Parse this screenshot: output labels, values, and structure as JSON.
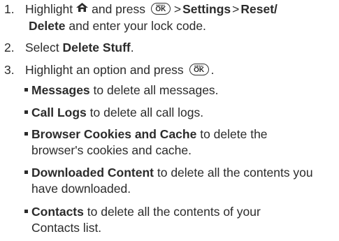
{
  "steps": [
    {
      "number": "1.",
      "line1_prefix": "Highlight",
      "line1_mid": "and press",
      "arrow1": ">",
      "settings": "Settings",
      "arrow2": ">",
      "reset_line1": "Reset/",
      "reset_line2": "Delete",
      "line2_suffix": "and enter your lock code."
    },
    {
      "number": "2.",
      "prefix": "Select",
      "target": "Delete Stuff",
      "suffix": "."
    },
    {
      "number": "3.",
      "prefix": "Highlight an option and press",
      "suffix": "."
    }
  ],
  "ok_button": {
    "menu_text": "MENU",
    "ok_text": "OK"
  },
  "options": [
    {
      "name": "Messages",
      "desc_line1": "to delete all messages.",
      "desc_line2": ""
    },
    {
      "name": "Call Logs",
      "desc_line1": "to delete all call logs.",
      "desc_line2": ""
    },
    {
      "name": "Browser Cookies and Cache",
      "desc_line1": "to delete the",
      "desc_line2": "browser's cookies and cache."
    },
    {
      "name": "Downloaded Content",
      "desc_line1": "to delete all the contents you",
      "desc_line2": "have downloaded."
    },
    {
      "name": "Contacts",
      "desc_line1": "to delete all the contents of your",
      "desc_line2": "Contacts list."
    }
  ],
  "icons": {
    "home": "home-icon",
    "ok": "menu-ok-button-icon"
  },
  "colors": {
    "text": "#2b2b2b"
  }
}
